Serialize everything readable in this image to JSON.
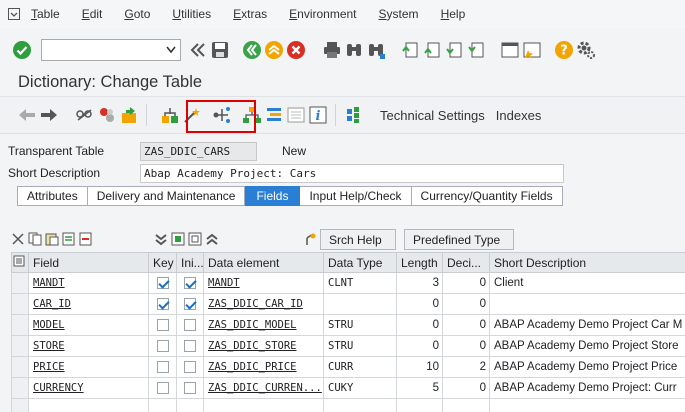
{
  "menu": [
    "Table",
    "Edit",
    "Goto",
    "Utilities",
    "Extras",
    "Environment",
    "System",
    "Help"
  ],
  "title": "Dictionary: Change Table",
  "toolbar": {
    "technical_settings": "Technical Settings",
    "indexes": "Indexes"
  },
  "header": {
    "type_label": "Transparent Table",
    "table_name": "ZAS_DDIC_CARS",
    "status": "New",
    "desc_label": "Short Description",
    "description": "Abap Academy Project: Cars"
  },
  "tabs": [
    "Attributes",
    "Delivery and Maintenance",
    "Fields",
    "Input Help/Check",
    "Currency/Quantity Fields"
  ],
  "active_tab": "Fields",
  "buttons": {
    "srch_help": "Srch Help",
    "predefined_type": "Predefined Type"
  },
  "columns": [
    "Field",
    "Key",
    "Ini...",
    "Data element",
    "Data Type",
    "Length",
    "Deci...",
    "Short Description"
  ],
  "rows": [
    {
      "field": "MANDT",
      "key": true,
      "ini": true,
      "element": "MANDT",
      "type": "CLNT",
      "length": "3",
      "dec": "0",
      "desc": "Client"
    },
    {
      "field": "CAR_ID",
      "key": true,
      "ini": true,
      "element": "ZAS_DDIC_CAR_ID",
      "type": "",
      "length": "0",
      "dec": "0",
      "desc": ""
    },
    {
      "field": "MODEL",
      "key": false,
      "ini": false,
      "element": "ZAS_DDIC_MODEL",
      "type": "STRU",
      "length": "0",
      "dec": "0",
      "desc": "ABAP Academy Demo Project Car M"
    },
    {
      "field": "STORE",
      "key": false,
      "ini": false,
      "element": "ZAS_DDIC_STORE",
      "type": "STRU",
      "length": "0",
      "dec": "0",
      "desc": "ABAP Academy Demo Project Store"
    },
    {
      "field": "PRICE",
      "key": false,
      "ini": false,
      "element": "ZAS_DDIC_PRICE",
      "type": "CURR",
      "length": "10",
      "dec": "2",
      "desc": "ABAP Academy Demo Project Price"
    },
    {
      "field": "CURRENCY",
      "key": false,
      "ini": false,
      "element": "ZAS_DDIC_CURREN...",
      "type": "CUKY",
      "length": "5",
      "dec": "0",
      "desc": "ABAP Academy Demo Project: Curr"
    }
  ],
  "colors": {
    "accent": "#2a7fd4",
    "highlight": "#e00000",
    "ok": "#2e9e3e",
    "back": "#3aa34a",
    "exit": "#f2a400",
    "cancel": "#d93025"
  }
}
